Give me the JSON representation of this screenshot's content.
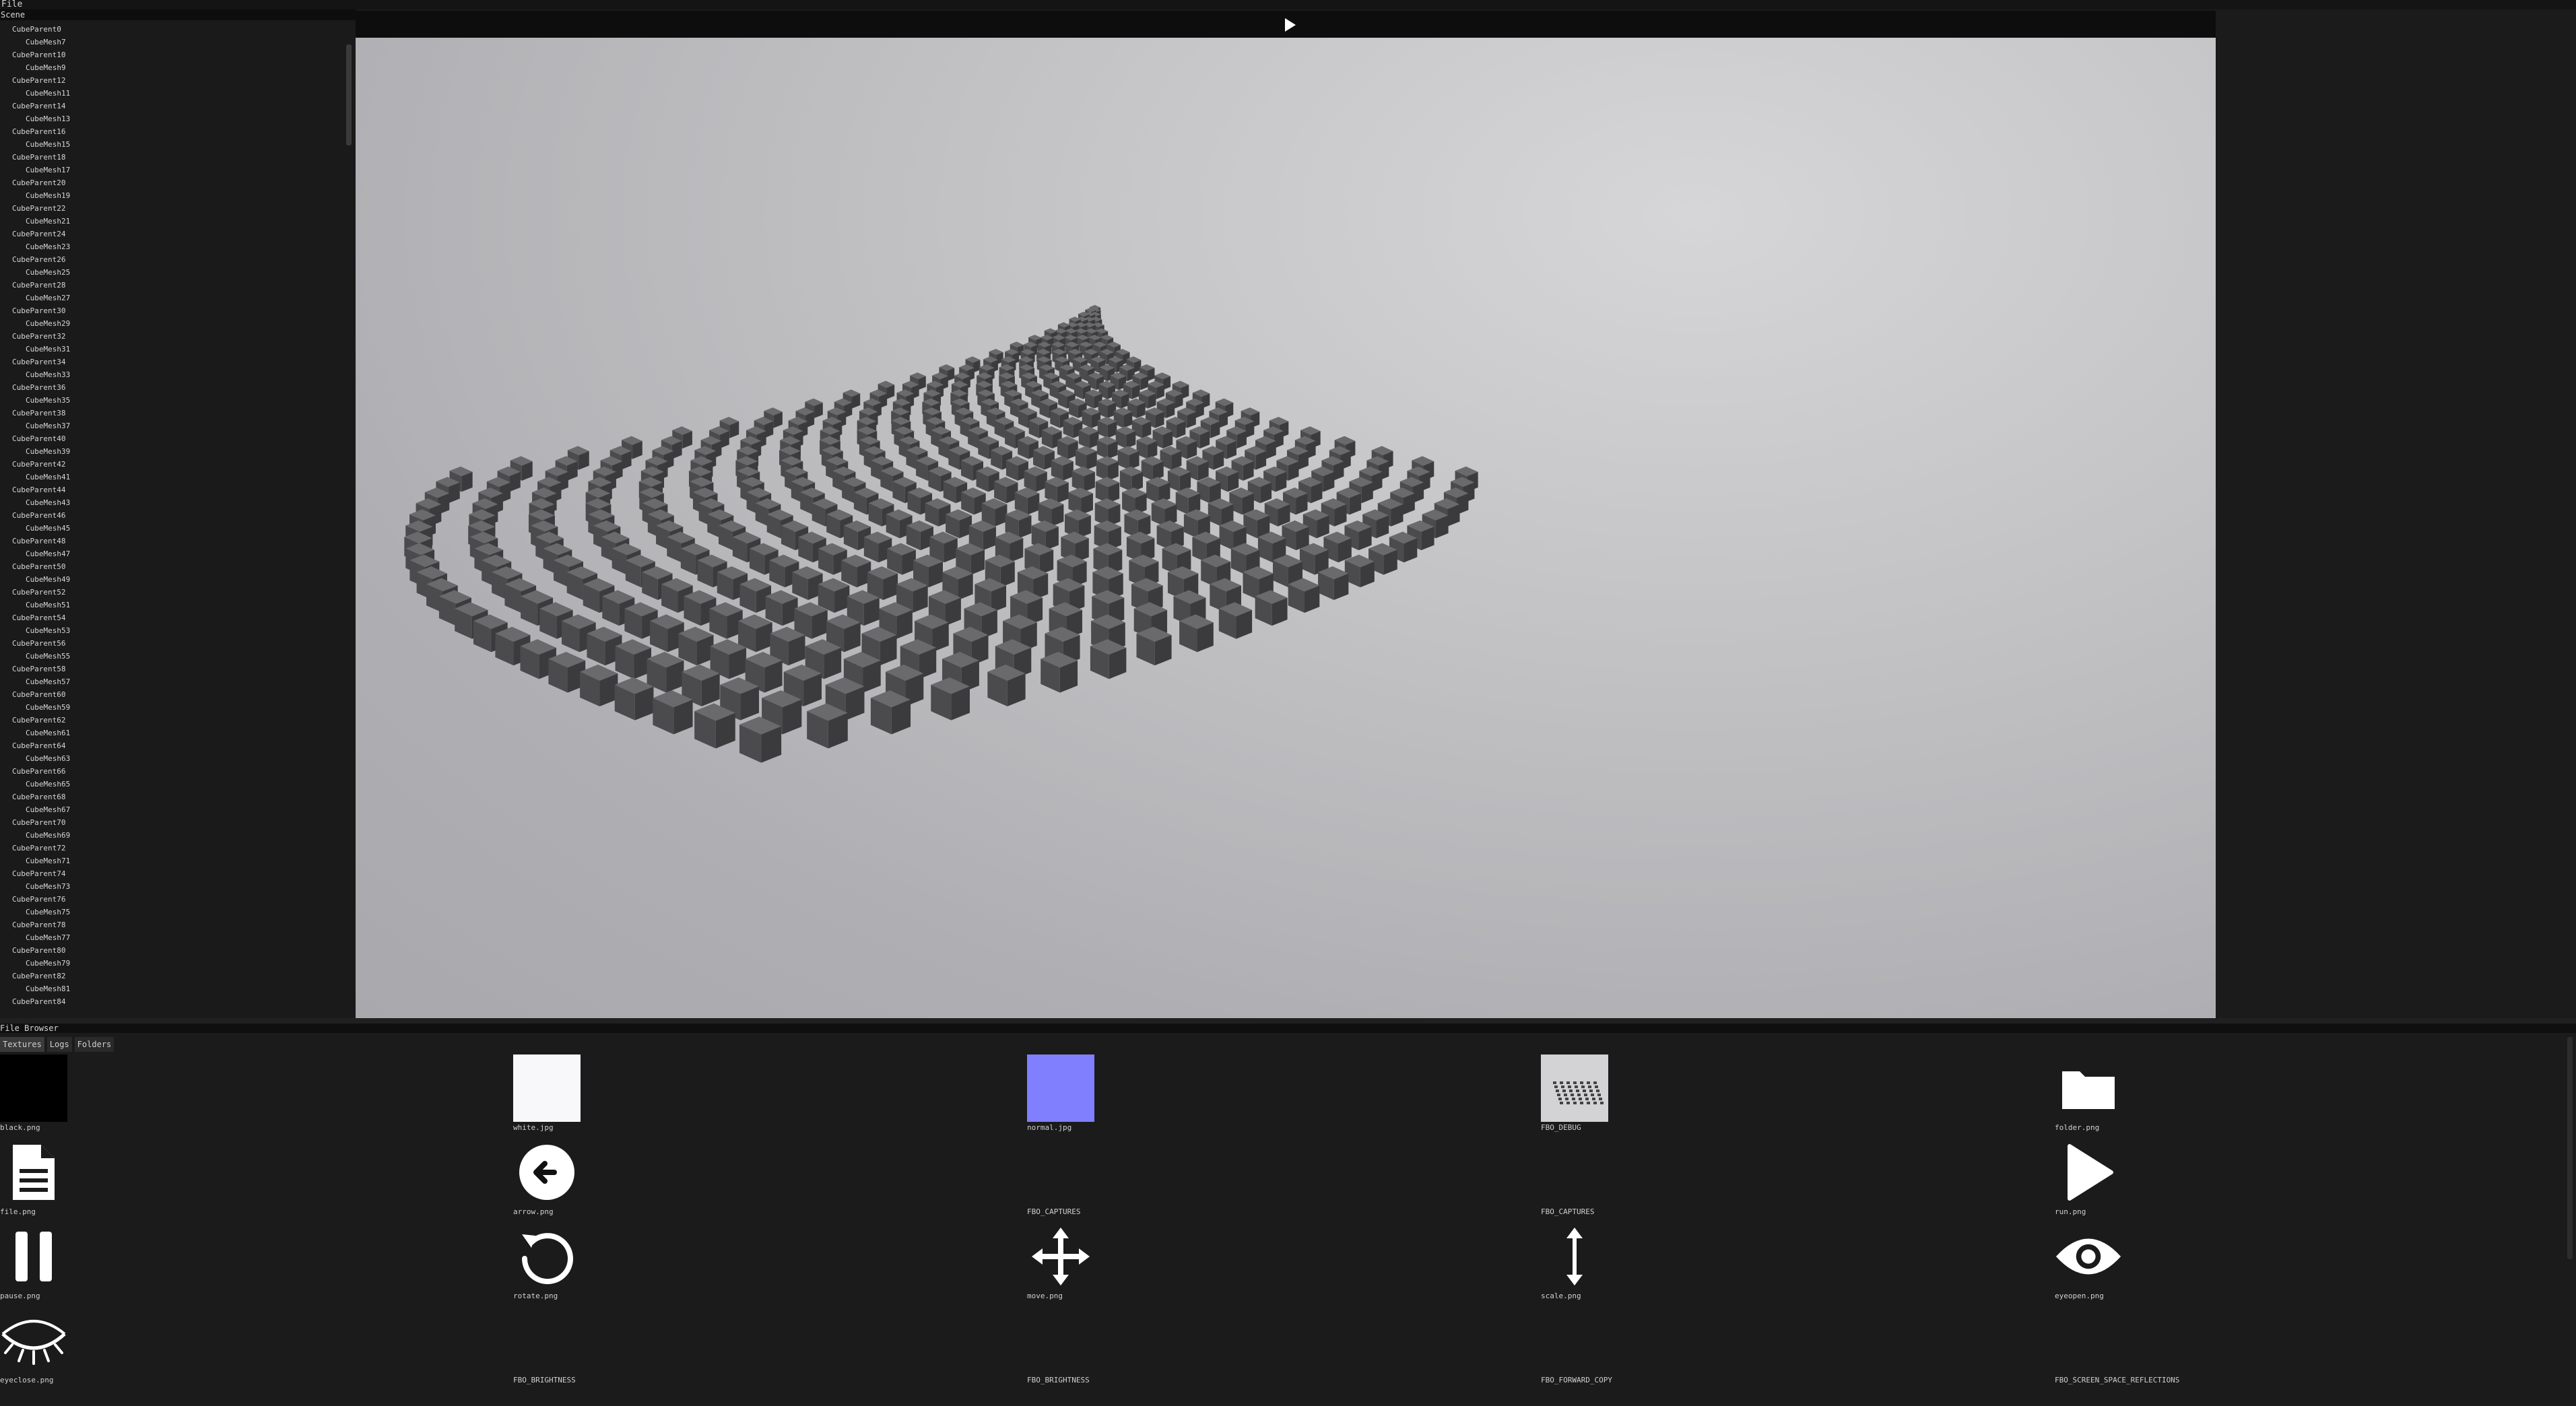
{
  "menu": {
    "file": "File"
  },
  "scene": {
    "title": "Scene",
    "items": [
      {
        "label": "CubeParent0",
        "kind": "parent"
      },
      {
        "label": "CubeMesh7",
        "kind": "child"
      },
      {
        "label": "CubeParent10",
        "kind": "parent"
      },
      {
        "label": "CubeMesh9",
        "kind": "child"
      },
      {
        "label": "CubeParent12",
        "kind": "parent"
      },
      {
        "label": "CubeMesh11",
        "kind": "child"
      },
      {
        "label": "CubeParent14",
        "kind": "parent"
      },
      {
        "label": "CubeMesh13",
        "kind": "child"
      },
      {
        "label": "CubeParent16",
        "kind": "parent"
      },
      {
        "label": "CubeMesh15",
        "kind": "child"
      },
      {
        "label": "CubeParent18",
        "kind": "parent"
      },
      {
        "label": "CubeMesh17",
        "kind": "child"
      },
      {
        "label": "CubeParent20",
        "kind": "parent"
      },
      {
        "label": "CubeMesh19",
        "kind": "child"
      },
      {
        "label": "CubeParent22",
        "kind": "parent"
      },
      {
        "label": "CubeMesh21",
        "kind": "child"
      },
      {
        "label": "CubeParent24",
        "kind": "parent"
      },
      {
        "label": "CubeMesh23",
        "kind": "child"
      },
      {
        "label": "CubeParent26",
        "kind": "parent"
      },
      {
        "label": "CubeMesh25",
        "kind": "child"
      },
      {
        "label": "CubeParent28",
        "kind": "parent"
      },
      {
        "label": "CubeMesh27",
        "kind": "child"
      },
      {
        "label": "CubeParent30",
        "kind": "parent"
      },
      {
        "label": "CubeMesh29",
        "kind": "child"
      },
      {
        "label": "CubeParent32",
        "kind": "parent"
      },
      {
        "label": "CubeMesh31",
        "kind": "child"
      },
      {
        "label": "CubeParent34",
        "kind": "parent"
      },
      {
        "label": "CubeMesh33",
        "kind": "child"
      },
      {
        "label": "CubeParent36",
        "kind": "parent"
      },
      {
        "label": "CubeMesh35",
        "kind": "child"
      },
      {
        "label": "CubeParent38",
        "kind": "parent"
      },
      {
        "label": "CubeMesh37",
        "kind": "child"
      },
      {
        "label": "CubeParent40",
        "kind": "parent"
      },
      {
        "label": "CubeMesh39",
        "kind": "child"
      },
      {
        "label": "CubeParent42",
        "kind": "parent"
      },
      {
        "label": "CubeMesh41",
        "kind": "child"
      },
      {
        "label": "CubeParent44",
        "kind": "parent"
      },
      {
        "label": "CubeMesh43",
        "kind": "child"
      },
      {
        "label": "CubeParent46",
        "kind": "parent"
      },
      {
        "label": "CubeMesh45",
        "kind": "child"
      },
      {
        "label": "CubeParent48",
        "kind": "parent"
      },
      {
        "label": "CubeMesh47",
        "kind": "child"
      },
      {
        "label": "CubeParent50",
        "kind": "parent"
      },
      {
        "label": "CubeMesh49",
        "kind": "child"
      },
      {
        "label": "CubeParent52",
        "kind": "parent"
      },
      {
        "label": "CubeMesh51",
        "kind": "child"
      },
      {
        "label": "CubeParent54",
        "kind": "parent"
      },
      {
        "label": "CubeMesh53",
        "kind": "child"
      },
      {
        "label": "CubeParent56",
        "kind": "parent"
      },
      {
        "label": "CubeMesh55",
        "kind": "child"
      },
      {
        "label": "CubeParent58",
        "kind": "parent"
      },
      {
        "label": "CubeMesh57",
        "kind": "child"
      },
      {
        "label": "CubeParent60",
        "kind": "parent"
      },
      {
        "label": "CubeMesh59",
        "kind": "child"
      },
      {
        "label": "CubeParent62",
        "kind": "parent"
      },
      {
        "label": "CubeMesh61",
        "kind": "child"
      },
      {
        "label": "CubeParent64",
        "kind": "parent"
      },
      {
        "label": "CubeMesh63",
        "kind": "child"
      },
      {
        "label": "CubeParent66",
        "kind": "parent"
      },
      {
        "label": "CubeMesh65",
        "kind": "child"
      },
      {
        "label": "CubeParent68",
        "kind": "parent"
      },
      {
        "label": "CubeMesh67",
        "kind": "child"
      },
      {
        "label": "CubeParent70",
        "kind": "parent"
      },
      {
        "label": "CubeMesh69",
        "kind": "child"
      },
      {
        "label": "CubeParent72",
        "kind": "parent"
      },
      {
        "label": "CubeMesh71",
        "kind": "child"
      },
      {
        "label": "CubeParent74",
        "kind": "parent"
      },
      {
        "label": "CubeMesh73",
        "kind": "child"
      },
      {
        "label": "CubeParent76",
        "kind": "parent"
      },
      {
        "label": "CubeMesh75",
        "kind": "child"
      },
      {
        "label": "CubeParent78",
        "kind": "parent"
      },
      {
        "label": "CubeMesh77",
        "kind": "child"
      },
      {
        "label": "CubeParent80",
        "kind": "parent"
      },
      {
        "label": "CubeMesh79",
        "kind": "child"
      },
      {
        "label": "CubeParent82",
        "kind": "parent"
      },
      {
        "label": "CubeMesh81",
        "kind": "child"
      },
      {
        "label": "CubeParent84",
        "kind": "parent"
      }
    ]
  },
  "viewport": {
    "play_icon": "play-icon"
  },
  "file_browser": {
    "title": "File Browser",
    "tabs": [
      {
        "label": "Textures",
        "active": true
      },
      {
        "label": "Logs",
        "active": false
      },
      {
        "label": "Folders",
        "active": false
      }
    ],
    "items": [
      {
        "label": "black.png",
        "icon": "black-swatch",
        "color": "#000000"
      },
      {
        "label": "white.jpg",
        "icon": "white-swatch",
        "color": "#f8f8fa"
      },
      {
        "label": "normal.jpg",
        "icon": "normal-swatch",
        "color": "#8080ff"
      },
      {
        "label": "FBO_DEBUG",
        "icon": "fbo-debug-thumbnail"
      },
      {
        "label": "folder.png",
        "icon": "folder-icon"
      },
      {
        "label": "file.png",
        "icon": "file-icon"
      },
      {
        "label": "arrow.png",
        "icon": "arrow-left-icon"
      },
      {
        "label": "FBO_CAPTURES",
        "icon": "empty"
      },
      {
        "label": "FBO_CAPTURES",
        "icon": "empty"
      },
      {
        "label": "run.png",
        "icon": "play-icon"
      },
      {
        "label": "pause.png",
        "icon": "pause-icon"
      },
      {
        "label": "rotate.png",
        "icon": "rotate-icon"
      },
      {
        "label": "move.png",
        "icon": "move-icon"
      },
      {
        "label": "scale.png",
        "icon": "scale-icon"
      },
      {
        "label": "eyeopen.png",
        "icon": "eye-open-icon"
      },
      {
        "label": "eyeclose.png",
        "icon": "eye-closed-icon"
      },
      {
        "label": "FBO_BRIGHTNESS",
        "icon": "empty"
      },
      {
        "label": "FBO_BRIGHTNESS",
        "icon": "empty"
      },
      {
        "label": "FBO_FORWARD_COPY",
        "icon": "empty"
      },
      {
        "label": "FBO_SCREEN_SPACE_REFLECTIONS",
        "icon": "empty"
      }
    ]
  }
}
